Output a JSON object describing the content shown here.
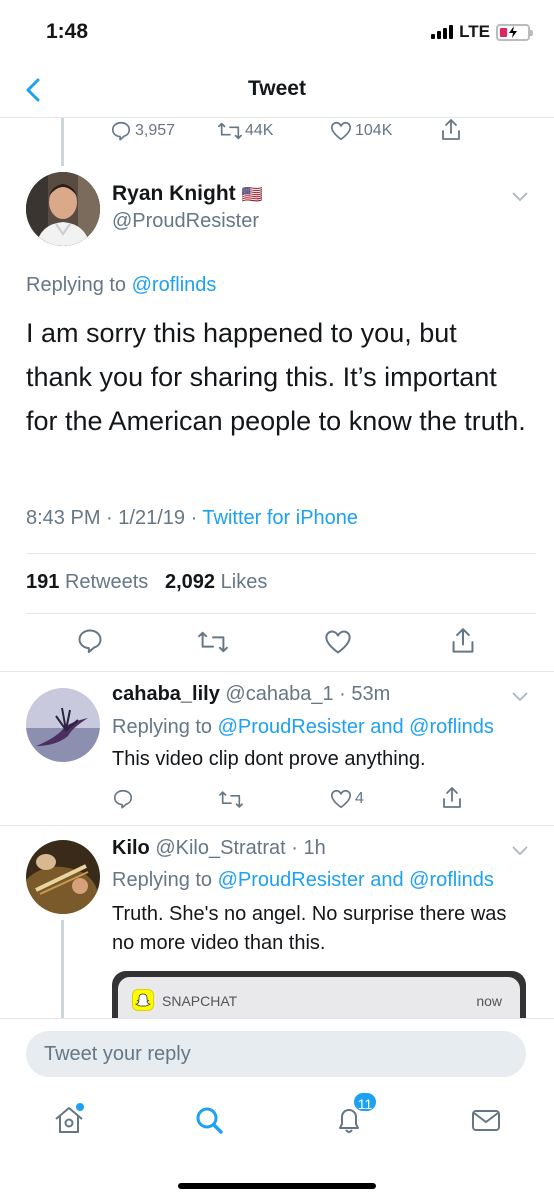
{
  "status": {
    "time": "1:48",
    "network": "LTE"
  },
  "nav": {
    "title": "Tweet"
  },
  "top_actions": {
    "replies": "3,957",
    "retweets": "44K",
    "likes": "104K"
  },
  "main_tweet": {
    "name": "Ryan Knight",
    "flag": "🇺🇸",
    "handle": "@ProudResister",
    "replying_prefix": "Replying to",
    "replying_to": "@roflinds",
    "text": "I am sorry this happened to you, but thank you for sharing this. It’s important for the American people to know the truth.",
    "time": "8:43 PM",
    "date": "1/21/19",
    "source": "Twitter for iPhone",
    "retweets_count": "191",
    "retweets_label": "Retweets",
    "likes_count": "2,092",
    "likes_label": "Likes"
  },
  "replies": [
    {
      "name": "cahaba_lily",
      "handle": "@cahaba_1",
      "age": "53m",
      "replying_prefix": "Replying to",
      "replying_to_1": "@ProudResister",
      "and": "and",
      "replying_to_2": "@roflinds",
      "text": "This video clip dont prove anything.",
      "likes": "4"
    },
    {
      "name": "Kilo",
      "handle": "@Kilo_Stratrat",
      "age": "1h",
      "replying_prefix": "Replying to",
      "replying_to_1": "@ProudResister",
      "and": "and",
      "replying_to_2": "@roflinds",
      "text": "Truth. She's no angel. No surprise there was no more video than this.",
      "media": {
        "app": "SNAPCHAT",
        "time": "now"
      }
    }
  ],
  "reply_bar": {
    "placeholder": "Tweet your reply"
  },
  "tabbar": {
    "notifications_badge": "11"
  },
  "colors": {
    "accent": "#1da1f2",
    "text": "#14171a",
    "secondary": "#657786",
    "divider": "#e1e8ed"
  }
}
